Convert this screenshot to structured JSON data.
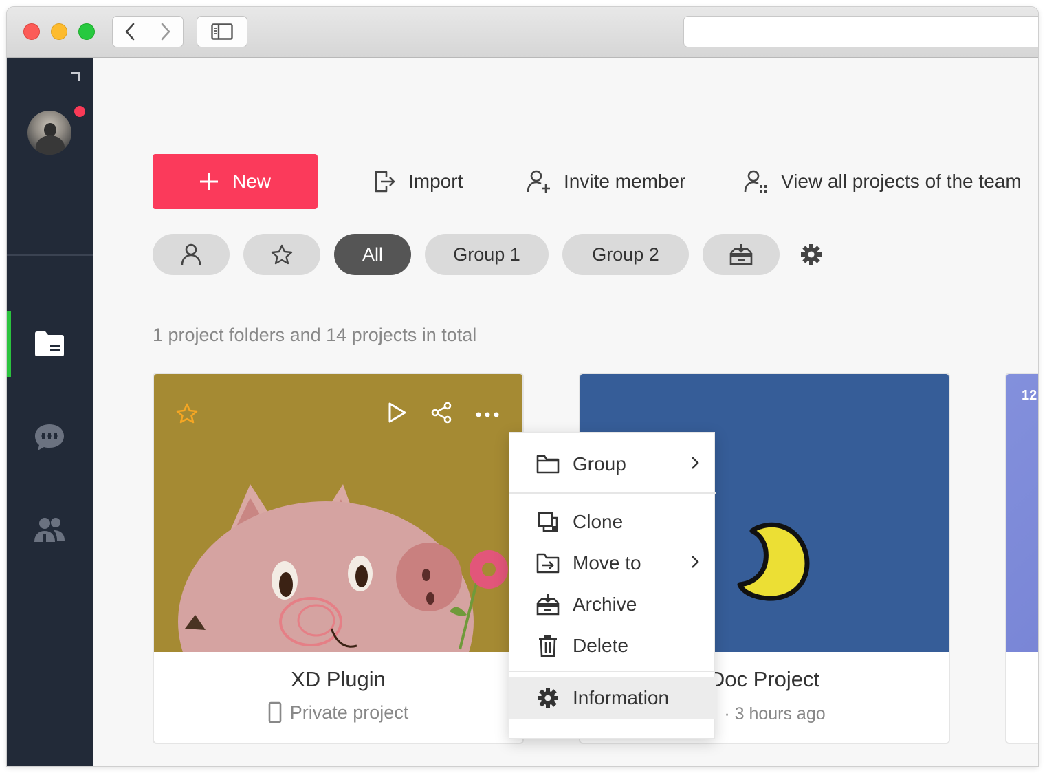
{
  "toolbar": {
    "new_label": "New",
    "import_label": "Import",
    "invite_label": "Invite member",
    "view_all_label": "View all projects of the team"
  },
  "filters": [
    {
      "id": "mine",
      "label": "",
      "icon": "user-icon",
      "active": false
    },
    {
      "id": "starred",
      "label": "",
      "icon": "star-icon",
      "active": false
    },
    {
      "id": "all",
      "label": "All",
      "active": true
    },
    {
      "id": "group1",
      "label": "Group 1",
      "active": false
    },
    {
      "id": "group2",
      "label": "Group 2",
      "active": false
    },
    {
      "id": "archived",
      "label": "",
      "icon": "archive-icon",
      "active": false
    }
  ],
  "summary": "1 project folders and 14 projects in total",
  "projects": [
    {
      "title": "XD Plugin",
      "meta": "Private project",
      "thumb_color": "#a58a33"
    },
    {
      "title": "Doc Project",
      "meta": "· 3 hours ago",
      "thumb_color": "#365d98"
    },
    {
      "title": "",
      "meta": "",
      "badge": "12",
      "thumb_color": "#7a86d8"
    }
  ],
  "context_menu": {
    "items": [
      {
        "label": "Group",
        "icon": "folder-icon",
        "submenu": true
      },
      {
        "label": "Clone",
        "icon": "clone-icon",
        "submenu": false
      },
      {
        "label": "Move to",
        "icon": "move-folder-icon",
        "submenu": true
      },
      {
        "label": "Archive",
        "icon": "archive-icon",
        "submenu": false
      },
      {
        "label": "Delete",
        "icon": "trash-icon",
        "submenu": false
      },
      {
        "label": "Information",
        "icon": "gear-icon",
        "submenu": false,
        "highlighted": true
      }
    ]
  },
  "colors": {
    "accent": "#fb3a5b",
    "sidebar": "#222a38",
    "active_indicator": "#2bc33e",
    "star": "#f5a623"
  }
}
